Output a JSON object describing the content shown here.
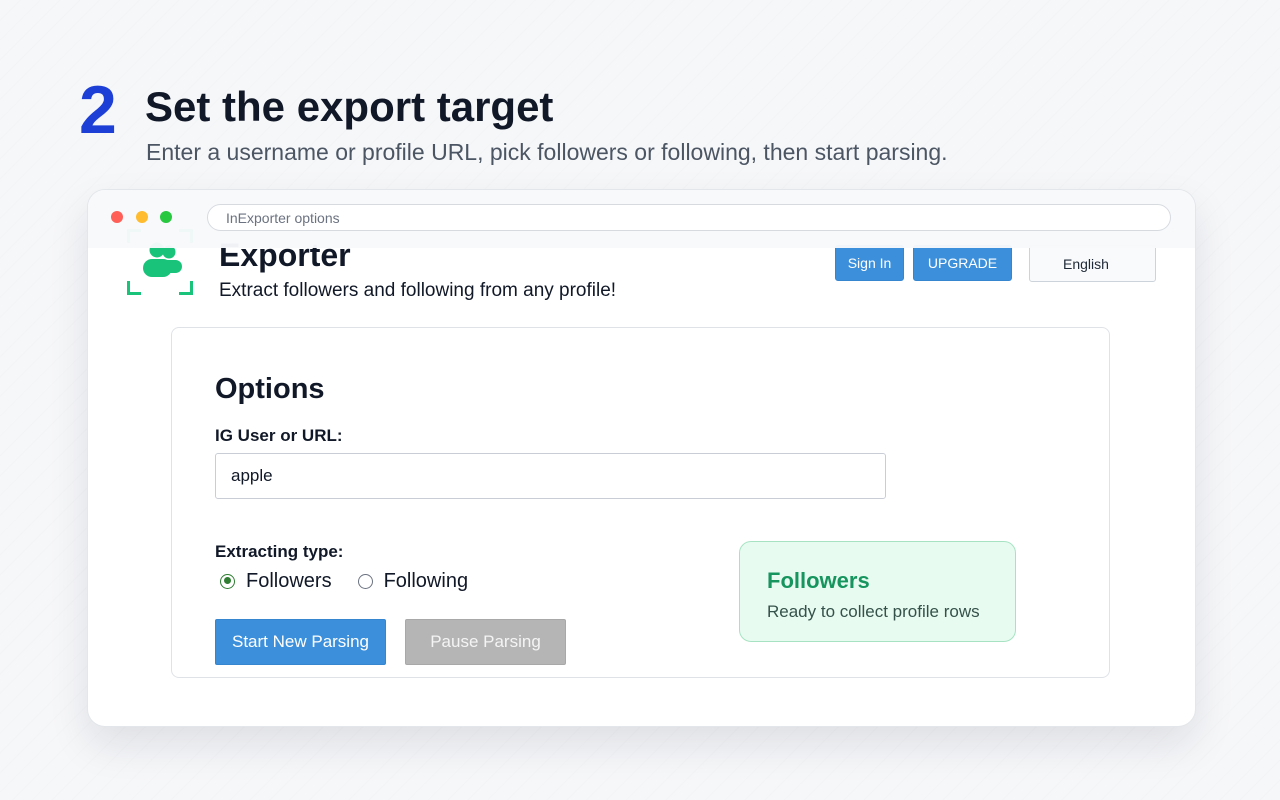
{
  "step": {
    "number": "2",
    "title": "Set the export target",
    "subtitle": "Enter a username or profile URL, pick followers or following, then start parsing."
  },
  "browser": {
    "url_text": "InExporter options"
  },
  "header": {
    "title": "Exporter",
    "subtitle": "Extract followers and following from any profile!",
    "signin_label": "Sign In",
    "upgrade_label": "UPGRADE",
    "language": "English"
  },
  "options": {
    "title": "Options",
    "ig_label": "IG User or URL:",
    "ig_value": "apple",
    "type_label": "Extracting type:",
    "types": [
      {
        "label": "Followers",
        "checked": true
      },
      {
        "label": "Following",
        "checked": false
      }
    ],
    "start_label": "Start New Parsing",
    "pause_label": "Pause Parsing"
  },
  "status": {
    "title": "Followers",
    "text": "Ready to collect profile rows"
  },
  "colors": {
    "accent_blue": "#3b8fdb",
    "step_blue": "#1d3fd6",
    "logo_green": "#19c47a",
    "status_green": "#16955e"
  },
  "icons": {
    "logo": "users-scan-icon"
  }
}
